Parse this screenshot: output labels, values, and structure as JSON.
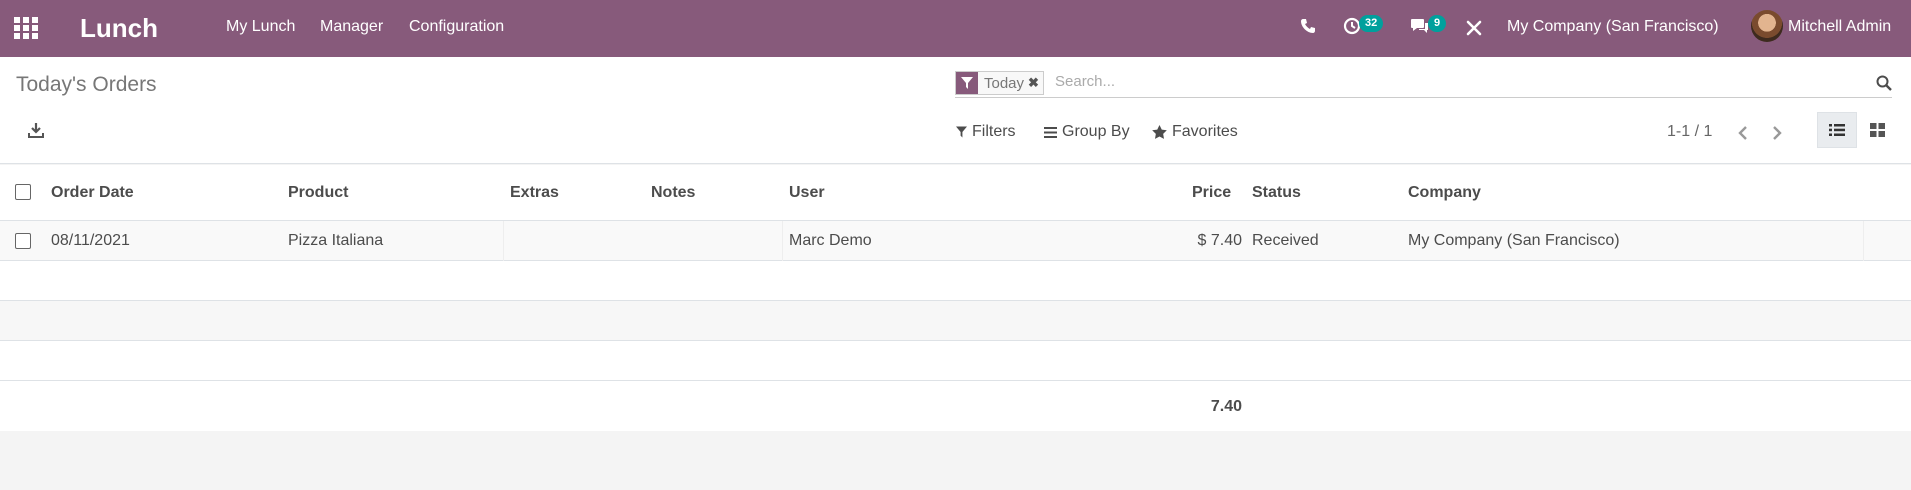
{
  "navbar": {
    "app_title": "Lunch",
    "menu": [
      "My Lunch",
      "Manager",
      "Configuration"
    ],
    "activity_count": "32",
    "messages_count": "9",
    "company": "My Company (San Francisco)",
    "user_name": "Mitchell Admin",
    "brand_color": "#875a7b",
    "badge_color": "#00a09d"
  },
  "control_panel": {
    "title": "Today's Orders",
    "facet_label": "Today",
    "search_placeholder": "Search...",
    "filters_label": "Filters",
    "groupby_label": "Group By",
    "favorites_label": "Favorites",
    "pager": "1-1 / 1"
  },
  "table": {
    "columns": [
      "Order Date",
      "Product",
      "Extras",
      "Notes",
      "User",
      "Price",
      "Status",
      "Company"
    ],
    "rows": [
      {
        "order_date": "08/11/2021",
        "product": "Pizza Italiana",
        "extras": "",
        "notes": "",
        "user": "Marc Demo",
        "price": "$ 7.40",
        "status": "Received",
        "company": "My Company (San Francisco)"
      }
    ],
    "total": "7.40"
  }
}
